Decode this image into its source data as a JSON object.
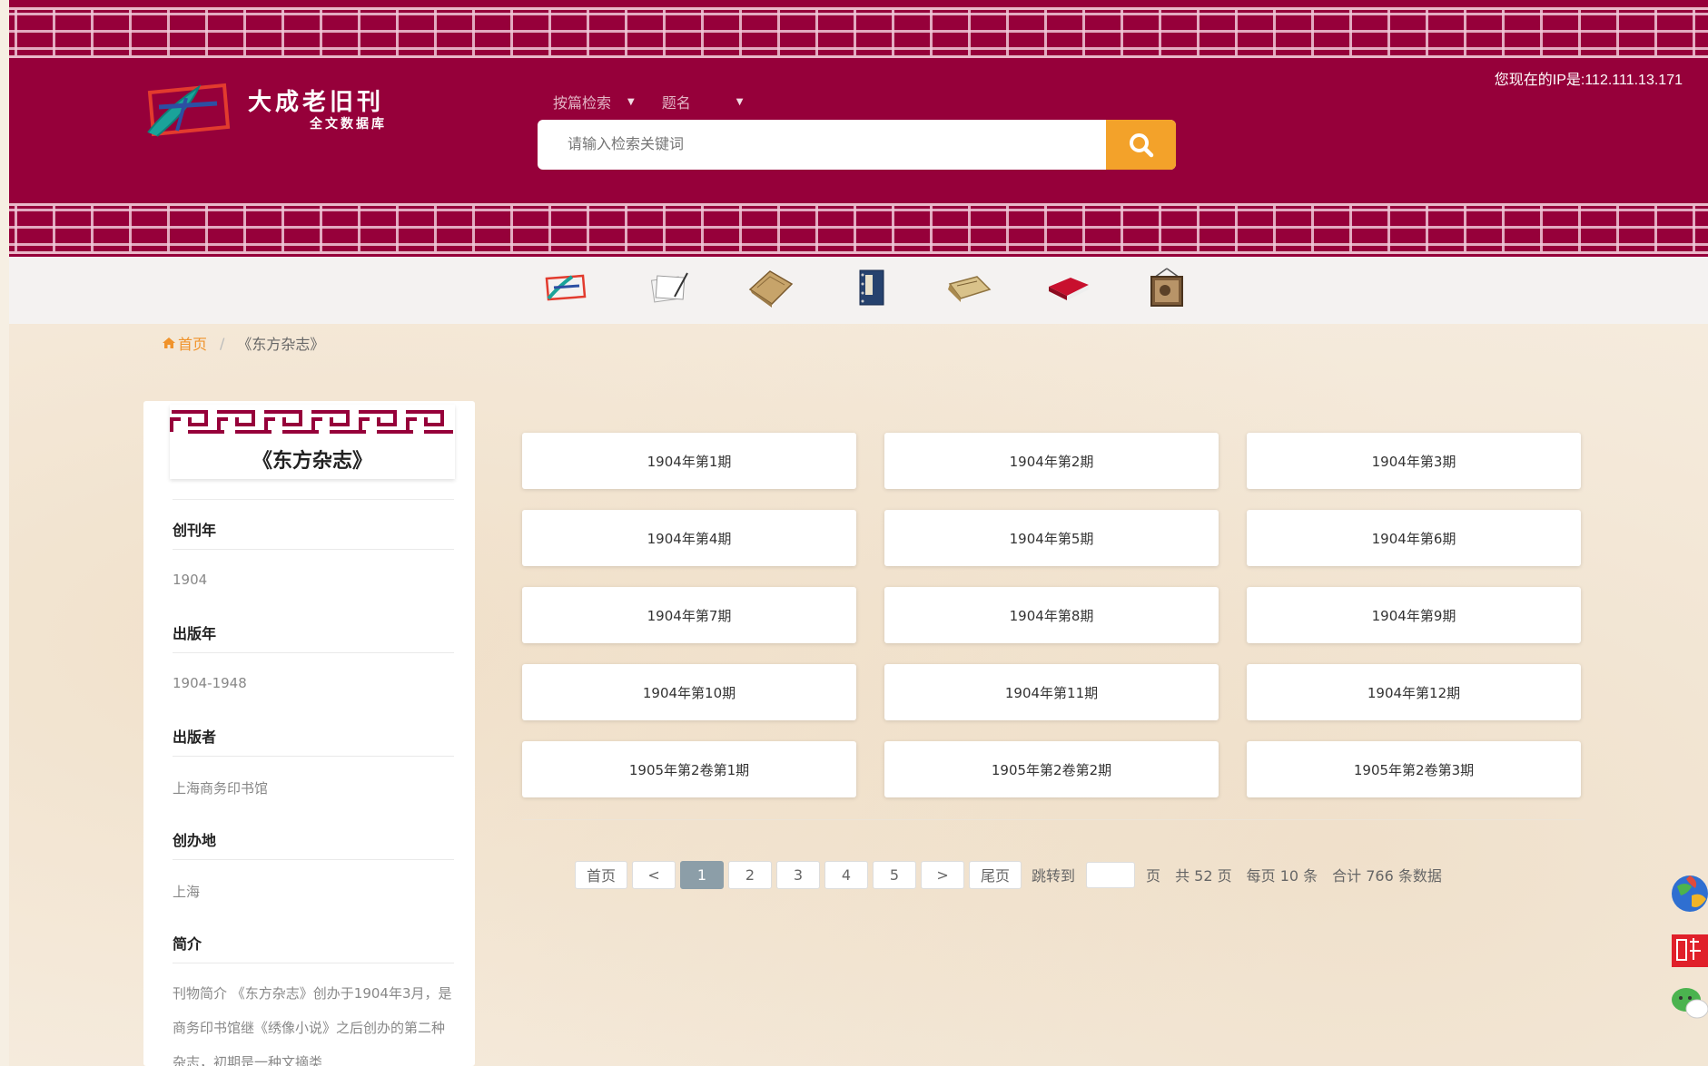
{
  "header": {
    "logo_title": "大成老旧刊",
    "logo_subtitle": "全文数据库",
    "ip_text": "您现在的IP是:112.111.13.171",
    "search_scope": "按篇检索",
    "search_field": "题名",
    "search_placeholder": "请输入检索关键词"
  },
  "nav_icons": [
    "logo-icon",
    "writing-paper-icon",
    "old-book-icon",
    "thread-bound-book-icon",
    "scroll-icon",
    "red-book-icon",
    "picture-frame-icon"
  ],
  "breadcrumb": {
    "home": "首页",
    "separator": "/",
    "current": "《东方杂志》"
  },
  "sidebar": {
    "journal_title": "《东方杂志》",
    "fields": [
      {
        "label": "创刊年",
        "value": "1904"
      },
      {
        "label": "出版年",
        "value": "1904-1948"
      },
      {
        "label": "出版者",
        "value": "上海商务印书馆"
      },
      {
        "label": "创办地",
        "value": "上海"
      }
    ],
    "intro_label": "简介",
    "intro_text": "刊物简介 《东方杂志》创办于1904年3月，是商务印书馆继《绣像小说》之后创办的第二种杂志，初期是一种文摘类"
  },
  "issues": [
    "1904年第1期",
    "1904年第2期",
    "1904年第3期",
    "1904年第4期",
    "1904年第5期",
    "1904年第6期",
    "1904年第7期",
    "1904年第8期",
    "1904年第9期",
    "1904年第10期",
    "1904年第11期",
    "1904年第12期",
    "1905年第2卷第1期",
    "1905年第2卷第2期",
    "1905年第2卷第3期"
  ],
  "pagination": {
    "first": "首页",
    "prev": "<",
    "pages": [
      "1",
      "2",
      "3",
      "4",
      "5"
    ],
    "current_page": "1",
    "next": ">",
    "last": "尾页",
    "jump_label": "跳转到",
    "page_unit": "页",
    "total_pages_text": "共 52 页",
    "per_page_text": "每页 10 条",
    "total_records_text": "合计 766 条数据"
  },
  "colors": {
    "header": "#96003a",
    "accent": "#f3a22a",
    "active_page": "#8c9ea8"
  }
}
